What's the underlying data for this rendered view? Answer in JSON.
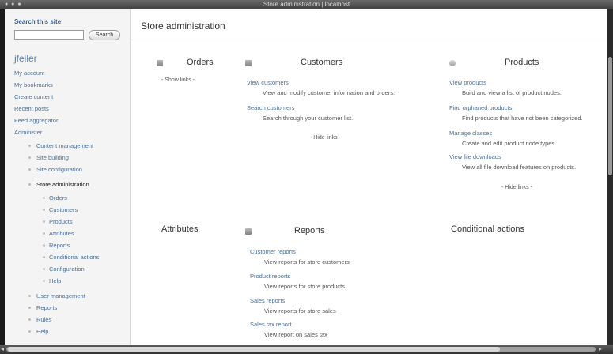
{
  "window": {
    "title": "Store administration | localhost"
  },
  "sidebar": {
    "search_label": "Search this site:",
    "search_value": "",
    "search_button": "Search",
    "username": "jfeiler",
    "items": [
      {
        "label": "My account"
      },
      {
        "label": "My bookmarks"
      },
      {
        "label": "Create content"
      },
      {
        "label": "Recent posts"
      },
      {
        "label": "Feed aggregator"
      },
      {
        "label": "Administer"
      },
      {
        "label": "Content management"
      },
      {
        "label": "Site building"
      },
      {
        "label": "Site configuration"
      },
      {
        "label": "Store administration"
      },
      {
        "label": "Orders"
      },
      {
        "label": "Customers"
      },
      {
        "label": "Products"
      },
      {
        "label": "Attributes"
      },
      {
        "label": "Reports"
      },
      {
        "label": "Conditional actions"
      },
      {
        "label": "Configuration"
      },
      {
        "label": "Help"
      },
      {
        "label": "User management"
      },
      {
        "label": "Reports"
      },
      {
        "label": "Rules"
      },
      {
        "label": "Help"
      }
    ]
  },
  "main": {
    "page_title": "Store administration",
    "orders": {
      "title": "Orders",
      "toggle": "- Show links -"
    },
    "customers": {
      "title": "Customers",
      "links": [
        {
          "title": "View customers",
          "desc": "View and modify customer information and orders."
        },
        {
          "title": "Search customers",
          "desc": "Search through your customer list."
        }
      ],
      "toggle": "- Hide links -"
    },
    "products": {
      "title": "Products",
      "links": [
        {
          "title": "View products",
          "desc": "Build and view a list of product nodes."
        },
        {
          "title": "Find orphaned products",
          "desc": "Find products that have not been categorized."
        },
        {
          "title": "Manage classes",
          "desc": "Create and edit product node types."
        },
        {
          "title": "View file downloads",
          "desc": "View all file download features on products."
        }
      ],
      "toggle": "- Hide links -"
    },
    "attributes": {
      "title": "Attributes"
    },
    "reports": {
      "title": "Reports",
      "links": [
        {
          "title": "Customer reports",
          "desc": "View reports for store customers"
        },
        {
          "title": "Product reports",
          "desc": "View reports for store products"
        },
        {
          "title": "Sales reports",
          "desc": "View reports for store sales"
        },
        {
          "title": "Sales tax report",
          "desc": "View report on sales tax"
        }
      ]
    },
    "conditional_actions": {
      "title": "Conditional actions"
    }
  }
}
